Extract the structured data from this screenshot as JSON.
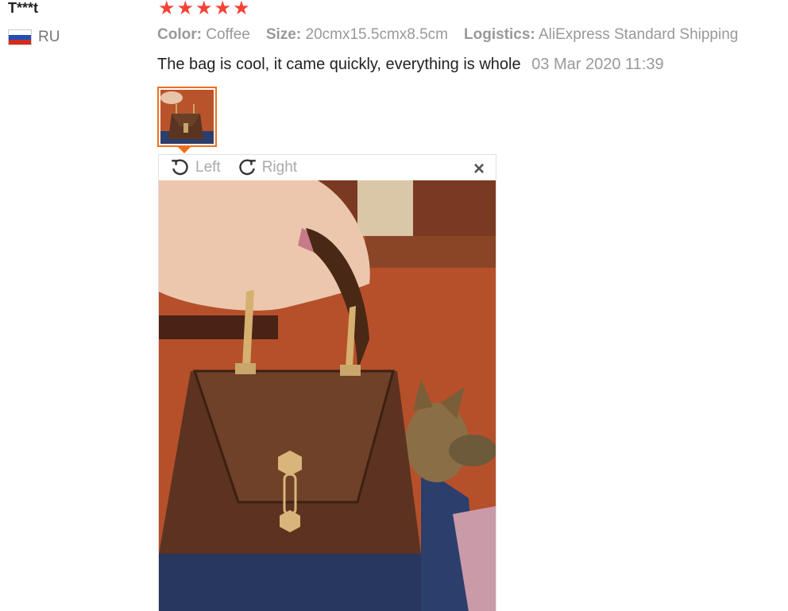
{
  "reviewer": {
    "name": "T***t",
    "country": "RU"
  },
  "rating": {
    "stars": 5,
    "max": 5
  },
  "meta": {
    "color_label": "Color:",
    "color_value": "Coffee",
    "size_label": "Size:",
    "size_value": "20cmx15.5cmx8.5cm",
    "logistics_label": "Logistics:",
    "logistics_value": "AliExpress Standard Shipping"
  },
  "review": {
    "text": "The bag is cool, it came quickly, everything is whole",
    "date": "03 Mar 2020 11:39"
  },
  "viewer": {
    "rotate_left_label": "Left",
    "rotate_right_label": "Right",
    "close_label": "×"
  },
  "colors": {
    "star": "#f44336",
    "accent": "#f06f1d"
  }
}
